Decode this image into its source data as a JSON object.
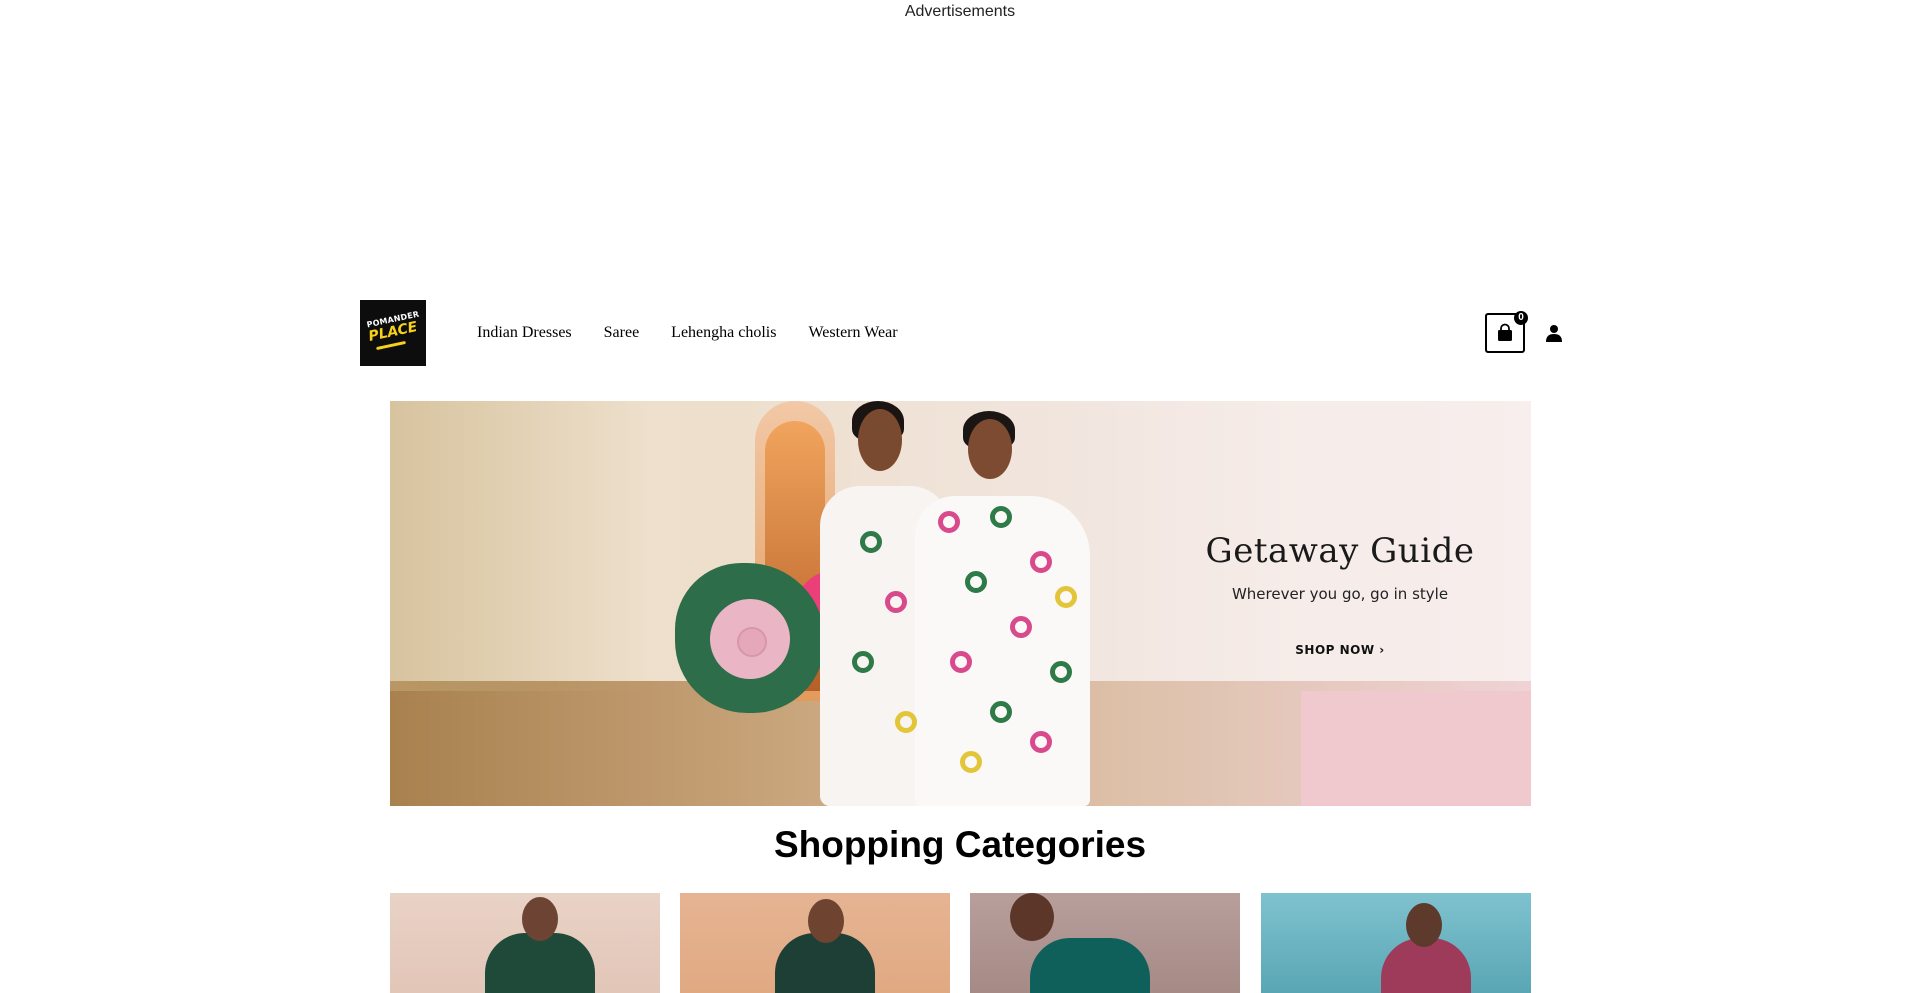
{
  "advertisement": {
    "label": "Advertisements"
  },
  "header": {
    "logo": {
      "line1": "POMANDER",
      "line2": "PLACE"
    },
    "nav": [
      {
        "label": "Indian Dresses"
      },
      {
        "label": "Saree"
      },
      {
        "label": "Lehengha cholis"
      },
      {
        "label": "Western Wear"
      }
    ],
    "cart_count": "0"
  },
  "hero": {
    "title": "Getaway Guide",
    "subtitle": "Wherever you go, go in style",
    "cta": "SHOP NOW ›"
  },
  "categories_section": {
    "title": "Shopping Categories"
  },
  "colors": {
    "ink": "#000000",
    "logo_bg": "#0d0d0d",
    "logo_accent": "#f7d21b",
    "hero_wall": "#ede1cc"
  },
  "icons": [
    "shopping-bag-icon",
    "user-icon",
    "chevron-right-icon"
  ]
}
